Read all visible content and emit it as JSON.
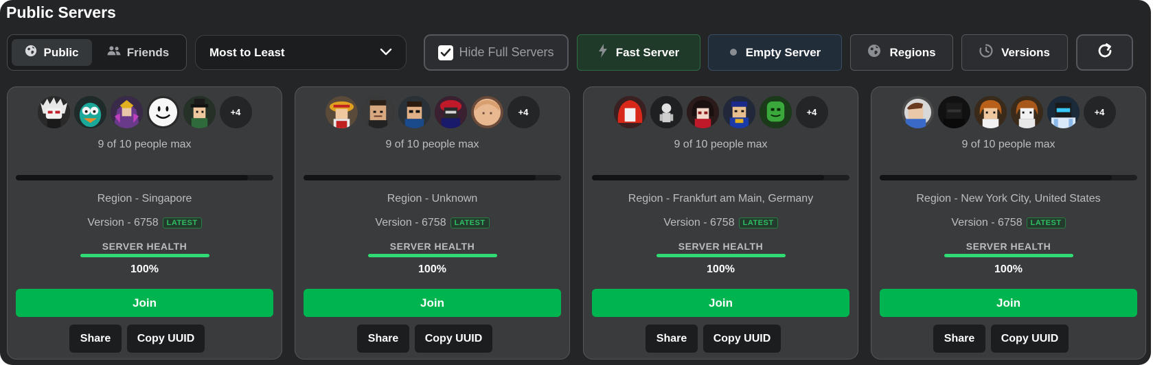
{
  "title": "Public Servers",
  "toolbar": {
    "tabs": [
      {
        "label": "Public",
        "icon": "globe-icon"
      },
      {
        "label": "Friends",
        "icon": "users-icon"
      }
    ],
    "sort": {
      "selected": "Most to Least"
    },
    "hide_full": {
      "label": "Hide Full Servers",
      "checked": true
    },
    "fast_server": {
      "label": "Fast Server",
      "icon": "lightning-icon",
      "color": "#1f3a28"
    },
    "empty_server": {
      "label": "Empty Server",
      "icon": "dot-icon",
      "color": "#222d3a"
    },
    "regions": {
      "label": "Regions",
      "icon": "globe-icon"
    },
    "versions": {
      "label": "Versions",
      "icon": "clock-icon"
    },
    "refresh": {
      "icon": "refresh-icon"
    }
  },
  "servers": [
    {
      "more": "+4",
      "people": "9 of 10 people max",
      "fill": 0.9,
      "region": "Region - Singapore",
      "version": "Version - 6758",
      "badge": "LATEST",
      "health_label": "SERVER HEALTH",
      "health": "100%",
      "join": "Join",
      "share": "Share",
      "copy": "Copy UUID"
    },
    {
      "more": "+4",
      "people": "9 of 10 people max",
      "fill": 0.9,
      "region": "Region - Unknown",
      "version": "Version - 6758",
      "badge": "LATEST",
      "health_label": "SERVER HEALTH",
      "health": "100%",
      "join": "Join",
      "share": "Share",
      "copy": "Copy UUID"
    },
    {
      "more": "+4",
      "people": "9 of 10 people max",
      "fill": 0.9,
      "region": "Region - Frankfurt am Main, Germany",
      "version": "Version - 6758",
      "badge": "LATEST",
      "health_label": "SERVER HEALTH",
      "health": "100%",
      "join": "Join",
      "share": "Share",
      "copy": "Copy UUID"
    },
    {
      "more": "+4",
      "people": "9 of 10 people max",
      "fill": 0.9,
      "region": "Region - New York City, United States",
      "version": "Version - 6758",
      "badge": "LATEST",
      "health_label": "SERVER HEALTH",
      "health": "100%",
      "join": "Join",
      "share": "Share",
      "copy": "Copy UUID"
    }
  ],
  "colors": {
    "accent_green": "#00b54f",
    "health_green": "#2fdb72",
    "card_bg": "#393b3d",
    "panel_bg": "#232527"
  }
}
